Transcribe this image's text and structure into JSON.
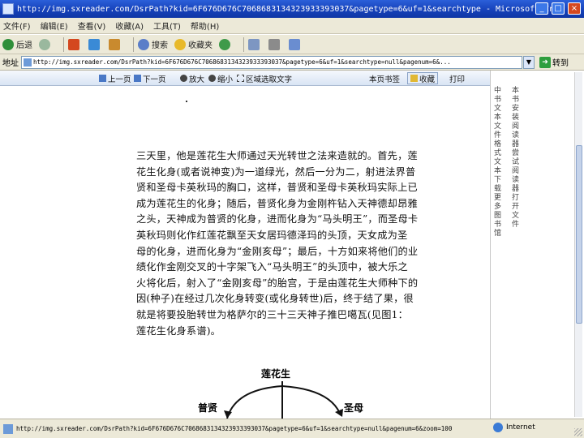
{
  "window": {
    "title": "http://img.sxreader.com/DsrPath?kid=6F676D676C7068683134323933393037&pagetype=6&uf=1&searchtype - Microsoft Inter..."
  },
  "menu": {
    "items": [
      "文件(F)",
      "编辑(E)",
      "查看(V)",
      "收藏(A)",
      "工具(T)",
      "帮助(H)"
    ]
  },
  "toolbar": {
    "back_label": "后退",
    "search_label": "搜索",
    "favorites_label": "收藏夹"
  },
  "address": {
    "label": "地址",
    "url": "http://img.sxreader.com/DsrPath?kid=6F676D676C7068683134323933393037&pagetype=6&uf=1&searchtype=null&pagenum=6&...",
    "go_label": "转到"
  },
  "reader_toolbar": {
    "prev_page": "上一页",
    "next_page": "下一页",
    "zoom_in": "放大",
    "zoom_out": "缩小",
    "select_text": "区域选取文字",
    "page_bookmark": "本页书签",
    "favorite": "收藏",
    "print": "打印"
  },
  "document": {
    "lines": [
      "三天里，他是莲花生大师通过天光转世之法来造就的。首先，莲",
      "花生化身(或者说神变)为一道绿光，然后一分为二，射进法界普",
      "贤和圣母卡英秋玛的胸口，这样，普贤和圣母卡英秋玛实际上已",
      "成为莲花生的化身；随后，普贤化身为金刚杵钻入天神德却昂雅",
      "之头，天神成为普贤的化身，进而化身为“马头明王”，而圣母卡",
      "英秋玛则化作红莲花飘至天女居玛德泽玛的头顶，天女成为圣",
      "母的化身，进而化身为“金刚亥母”；最后，十方如来将他们的业",
      "绩化作金刚交叉的十字架飞入“马头明王”的头顶中，被大乐之",
      "火将化后，射入了“金刚亥母”的胎宫，于是由莲花生大师种下的",
      "因(种子)在经过几次化身转变(或化身转世)后，终于结了果，很",
      "就是将要投胎转世为格萨尔的三十三天神子推巴噶瓦(见图1：",
      "莲花生化身系谱)。"
    ]
  },
  "diagram": {
    "root": "莲花生",
    "left": "普贤",
    "right": "圣母"
  },
  "side_panel": {
    "col1": "中书文本文件格式文本下载更多图书馆",
    "col2": "本书安装阅读器尝试阅读器打开文件"
  },
  "statusbar": {
    "text": "http://img.sxreader.com/DsrPath?kid=6F676D676C7068683134323933393037&pagetype=6&uf=1&searchtype=null&pagenum=6&zoom=100",
    "zone": "Internet"
  },
  "colors": {
    "titlebar": "#1540b8",
    "chrome": "#ece9d8",
    "reader_toolbar": "#d9e4f4"
  }
}
